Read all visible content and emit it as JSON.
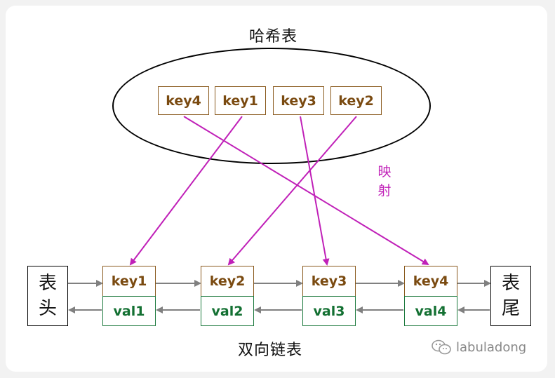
{
  "hash_table": {
    "title": "哈希表",
    "keys": [
      "key4",
      "key1",
      "key3",
      "key2"
    ]
  },
  "mapping_label": [
    "映",
    "射"
  ],
  "linked_list": {
    "title": "双向链表",
    "head": [
      "表",
      "头"
    ],
    "tail": [
      "表",
      "尾"
    ],
    "nodes": [
      {
        "key": "key1",
        "val": "val1"
      },
      {
        "key": "key2",
        "val": "val2"
      },
      {
        "key": "key3",
        "val": "val3"
      },
      {
        "key": "key4",
        "val": "val4"
      }
    ]
  },
  "watermark": "labuladong",
  "colors": {
    "key": "#7a4a10",
    "val": "#137032",
    "mapping": "#c020b8",
    "list_arrow": "#808080"
  }
}
